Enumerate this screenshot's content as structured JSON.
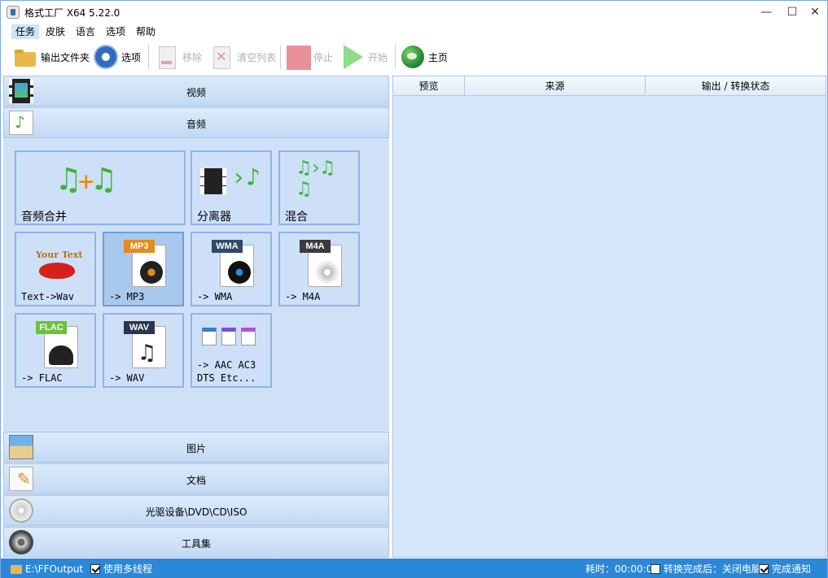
{
  "window": {
    "title": "格式工厂 X64 5.22.0",
    "controls": {
      "minimize": "—",
      "maximize": "☐",
      "close": "✕"
    }
  },
  "menu": [
    "任务",
    "皮肤",
    "语言",
    "选项",
    "帮助"
  ],
  "toolbar": {
    "output_folder": "输出文件夹",
    "options": "选项",
    "remove": "移除",
    "clear_list": "清空列表",
    "stop": "停止",
    "start": "开始",
    "home": "主页"
  },
  "categories": {
    "video": "视频",
    "audio": "音频",
    "picture": "图片",
    "document": "文档",
    "disc": "光驱设备\\DVD\\CD\\ISO",
    "tools": "工具集"
  },
  "audio_tiles": {
    "merge": "音频合并",
    "splitter": "分离器",
    "mix": "混合",
    "text_to_wav": "Text->Wav",
    "to_mp3": "-> MP3",
    "to_wma": "-> WMA",
    "to_m4a": "-> M4A",
    "to_flac": "-> FLAC",
    "to_wav": "-> WAV",
    "to_aac": "-> AAC AC3\nDTS Etc..."
  },
  "tile_art": {
    "your_text": "Your Text",
    "mp3_tag": "MP3",
    "wma_tag": "WMA",
    "m4a_tag": "M4A",
    "flac_tag": "FLAC",
    "wav_tag": "WAV"
  },
  "table": {
    "columns": [
      "预览",
      "来源",
      "输出 / 转换状态"
    ]
  },
  "statusbar": {
    "output_path": "E:\\FFOutput",
    "multithread": "使用多线程",
    "elapsed": "耗时：00:00:00",
    "after_done": "转换完成后：关闭电脑",
    "notify": "完成通知"
  },
  "colors": {
    "statusbar": "#2b87d8",
    "panel": "#cfe0f7",
    "tile_border": "#8fb5e6",
    "selected_tile": "#a8c8ee"
  }
}
